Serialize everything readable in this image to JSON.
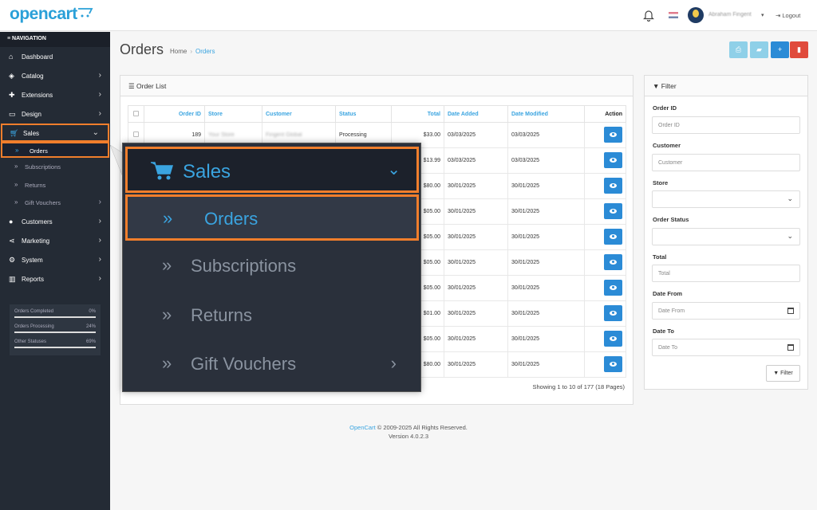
{
  "header": {
    "logo": "opencart",
    "user_name": "Abraham Fingent",
    "logout": "Logout"
  },
  "sidebar": {
    "nav_title": "NAVIGATION",
    "items": [
      {
        "label": "Dashboard",
        "icon": "home-icon"
      },
      {
        "label": "Catalog",
        "icon": "tag-icon"
      },
      {
        "label": "Extensions",
        "icon": "puzzle-icon"
      },
      {
        "label": "Design",
        "icon": "monitor-icon"
      },
      {
        "label": "Sales",
        "icon": "cart-icon"
      },
      {
        "label": "Customers",
        "icon": "user-icon"
      },
      {
        "label": "Marketing",
        "icon": "share-icon"
      },
      {
        "label": "System",
        "icon": "gear-icon"
      },
      {
        "label": "Reports",
        "icon": "bar-chart-icon"
      }
    ],
    "sales_sub": [
      "Orders",
      "Subscriptions",
      "Returns",
      "Gift Vouchers"
    ],
    "stats": [
      {
        "label": "Orders Completed",
        "pct": "0%"
      },
      {
        "label": "Orders Processing",
        "pct": "24%"
      },
      {
        "label": "Other Statuses",
        "pct": "69%"
      }
    ]
  },
  "page": {
    "title": "Orders",
    "breadcrumb_home": "Home",
    "breadcrumb_current": "Orders"
  },
  "order_list": {
    "title": "Order List",
    "columns": [
      "Order ID",
      "Store",
      "Customer",
      "Status",
      "Total",
      "Date Added",
      "Date Modified",
      "Action"
    ],
    "rows": [
      {
        "id": "189",
        "store": "Your Store",
        "customer": "Fingent Global",
        "status": "Processing",
        "total": "$33.00",
        "added": "03/03/2025",
        "modified": "03/03/2025"
      },
      {
        "id": "",
        "store": "",
        "customer": "",
        "status": "",
        "total": "$13.99",
        "added": "03/03/2025",
        "modified": "03/03/2025"
      },
      {
        "id": "",
        "store": "",
        "customer": "",
        "status": "",
        "total": "$80.00",
        "added": "30/01/2025",
        "modified": "30/01/2025"
      },
      {
        "id": "",
        "store": "",
        "customer": "",
        "status": "",
        "total": "$05.00",
        "added": "30/01/2025",
        "modified": "30/01/2025"
      },
      {
        "id": "",
        "store": "",
        "customer": "",
        "status": "",
        "total": "$05.00",
        "added": "30/01/2025",
        "modified": "30/01/2025"
      },
      {
        "id": "",
        "store": "",
        "customer": "",
        "status": "",
        "total": "$05.00",
        "added": "30/01/2025",
        "modified": "30/01/2025"
      },
      {
        "id": "",
        "store": "",
        "customer": "",
        "status": "",
        "total": "$05.00",
        "added": "30/01/2025",
        "modified": "30/01/2025"
      },
      {
        "id": "",
        "store": "",
        "customer": "",
        "status": "",
        "total": "$01.00",
        "added": "30/01/2025",
        "modified": "30/01/2025"
      },
      {
        "id": "",
        "store": "",
        "customer": "",
        "status": "",
        "total": "$05.00",
        "added": "30/01/2025",
        "modified": "30/01/2025"
      },
      {
        "id": "",
        "store": "",
        "customer": "",
        "status": "",
        "total": "$80.00",
        "added": "30/01/2025",
        "modified": "30/01/2025"
      }
    ],
    "showing": "Showing 1 to 10 of 177 (18 Pages)"
  },
  "filter": {
    "title": "Filter",
    "fields": [
      {
        "label": "Order ID",
        "placeholder": "Order ID"
      },
      {
        "label": "Customer",
        "placeholder": "Customer"
      },
      {
        "label": "Store",
        "placeholder": ""
      },
      {
        "label": "Order Status",
        "placeholder": ""
      },
      {
        "label": "Total",
        "placeholder": "Total"
      },
      {
        "label": "Date From",
        "placeholder": "Date From"
      },
      {
        "label": "Date To",
        "placeholder": "Date To"
      }
    ],
    "button": "Filter"
  },
  "footer": {
    "link": "OpenCart",
    "copyright": " © 2009-2025 All Rights Reserved.",
    "version": "Version 4.0.2.3"
  },
  "zoom": {
    "sales": "Sales",
    "orders": "Orders",
    "subscriptions": "Subscriptions",
    "returns": "Returns",
    "gift_vouchers": "Gift Vouchers"
  },
  "colors": {
    "accent": "#3aa4e0",
    "highlight": "#f07e2c",
    "sidebar": "#242b35",
    "btn_print": "#8fd0e8",
    "btn_ship": "#8fd0e8",
    "btn_add": "#2b8bd6",
    "btn_delete": "#e04b3c"
  }
}
